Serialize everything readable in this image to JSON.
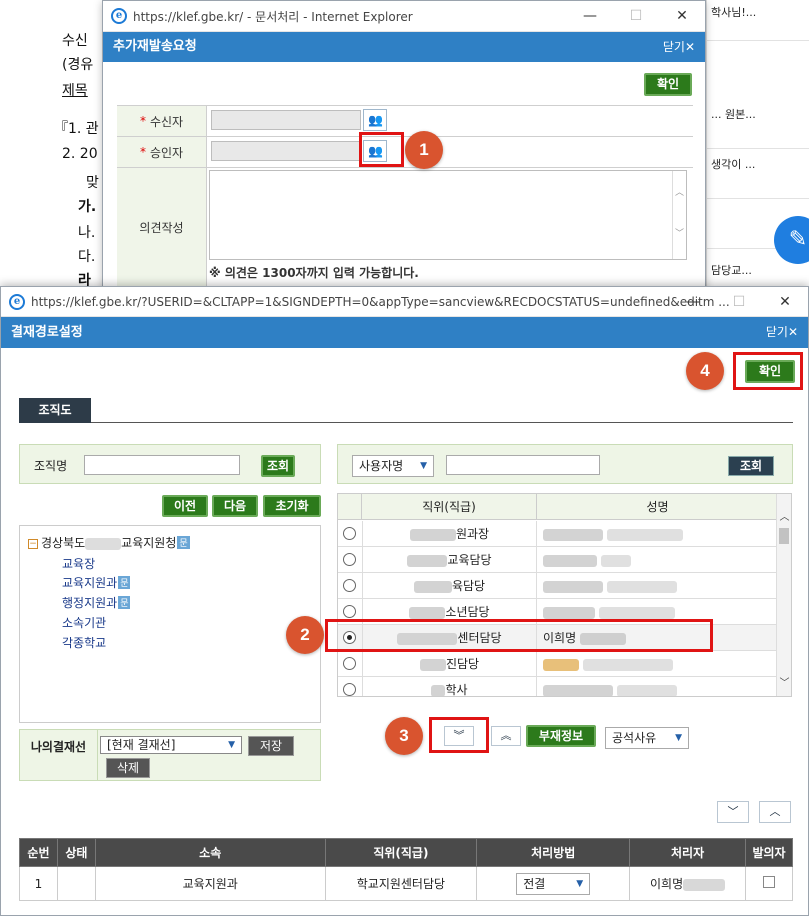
{
  "background": {
    "doc_lines": [
      "수신",
      "(경유",
      "제목",
      "『1. 관",
      "2. 20",
      "맞",
      "가.",
      "나.",
      "다.",
      "라"
    ],
    "right_items": [
      "학사님!...",
      "... 원본...",
      "생각이 ...",
      "담당교..."
    ]
  },
  "window1": {
    "address": "https://klef.gbe.kr/ - 문서처리 - Internet Explorer",
    "title": "추가재발송요청",
    "close_label": "닫기",
    "confirm_label": "확인",
    "recipient_label": "수신자",
    "approver_label": "승인자",
    "opinion_label": "의견작성",
    "note": "※ 의견은 1300자까지 입력 가능합니다."
  },
  "window2": {
    "address": "https://klef.gbe.kr/?USERID=&CLTAPP=1&SIGNDEPTH=0&appType=sancview&RECDOCSTATUS=undefined&editm ...",
    "title": "결재경로설정",
    "close_label": "닫기",
    "confirm_label": "확인",
    "tab_label": "조직도",
    "org_name_label": "조직명",
    "search_label": "조회",
    "prev_label": "이전",
    "next_label": "다음",
    "reset_label": "초기화",
    "user_select": "사용자명",
    "search2_label": "조회",
    "tree": {
      "root": "경상북도",
      "root_suffix": "교육지원청",
      "root_badge": "문",
      "children": [
        {
          "label": "교육장",
          "badge": ""
        },
        {
          "label": "교육지원과",
          "badge": "문"
        },
        {
          "label": "행정지원과",
          "badge": "문"
        },
        {
          "label": "소속기관",
          "badge": ""
        },
        {
          "label": "각종학교",
          "badge": ""
        }
      ]
    },
    "grid_headers": [
      "직위(직급)",
      "성명"
    ],
    "grid_rows": [
      {
        "position": "원과장",
        "name": "",
        "selected": false
      },
      {
        "position": "교육담당",
        "name": "",
        "selected": false
      },
      {
        "position": "육담당",
        "name": "",
        "selected": false
      },
      {
        "position": "소년담당",
        "name": "",
        "selected": false
      },
      {
        "position": "센터담당",
        "name": "이희명",
        "selected": true
      },
      {
        "position": "진담당",
        "name": "",
        "selected": false
      },
      {
        "position": "학사",
        "name": "",
        "selected": false
      }
    ],
    "my_line_label": "나의결재선",
    "my_line_value": "[현재 결재선]",
    "save_label": "저장",
    "delete_label": "삭제",
    "absence_label": "부재정보",
    "vacancy_select": "공석사유",
    "bottom_headers": [
      "순번",
      "상태",
      "소속",
      "직위(직급)",
      "처리방법",
      "처리자",
      "발의자"
    ],
    "bottom_rows": [
      {
        "no": "1",
        "status": "",
        "dept": "교육지원과",
        "position": "학교지원센터담당",
        "method": "전결",
        "handler": "이희명"
      }
    ]
  },
  "callouts": [
    "1",
    "2",
    "3",
    "4"
  ]
}
